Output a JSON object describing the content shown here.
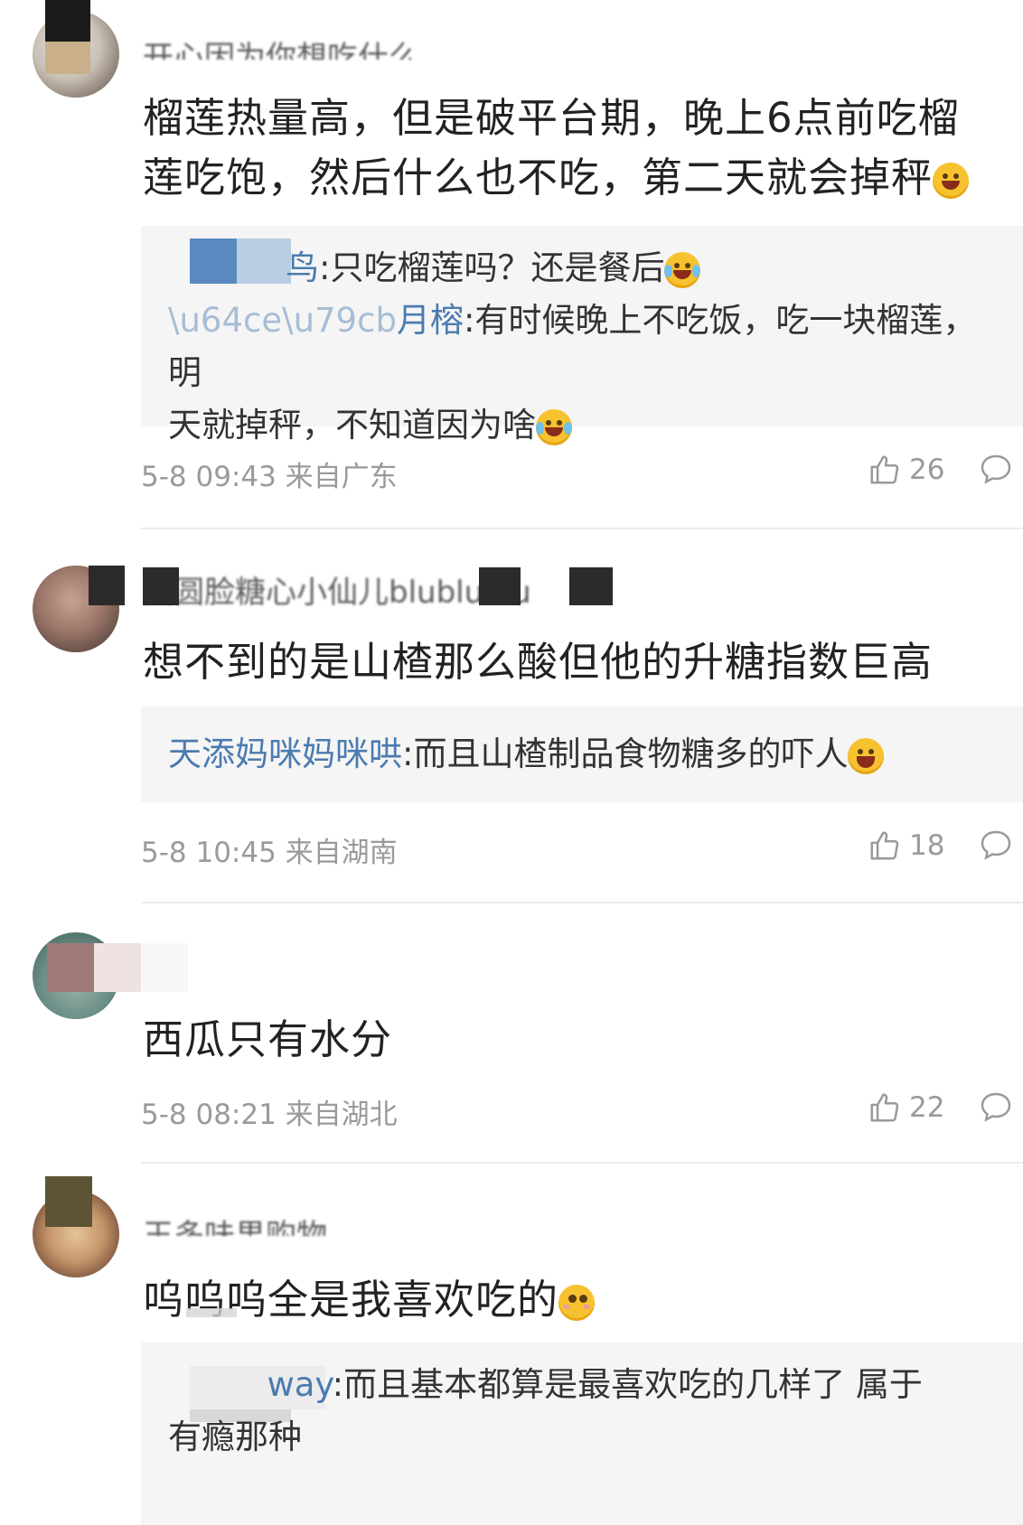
{
  "comments": [
    {
      "name": "开心因为你想吃什么",
      "text_a": "榴莲热量高，但是破平台期，晚上6点前吃榴",
      "text_b": "莲吃饱，然后什么也不吃，第二天就会掉秤",
      "emoji": "scream-emoji",
      "replies": [
        {
          "name": "鸟",
          "text": ":只吃榴莲吗？还是餐后",
          "emoji": "laugh-cry-emoji"
        },
        {
          "name": "月榕",
          "text": ":有时候晚上不吃饭，吃一块榴莲，明",
          "text_b": "天就掉秤，不知道因为啥",
          "emoji": "laugh-cry-emoji"
        }
      ],
      "meta": "5-8 09:43 来自广东",
      "likes": "26"
    },
    {
      "name": "圆圆脸糖心小仙儿blublublu",
      "text": "想不到的是山楂那么酸但他的升糖指数巨高",
      "replies": [
        {
          "name": "天添妈咪妈咪哄",
          "text": ":而且山楂制品食物糖多的吓人",
          "emoji": "grin-emoji"
        }
      ],
      "meta": "5-8 10:45 来自湖南",
      "likes": "18"
    },
    {
      "text": "西瓜只有水分",
      "meta": "5-8 08:21 来自湖北",
      "likes": "22"
    },
    {
      "name": "王多味果购物",
      "text": "呜呜呜全是我喜欢吃的",
      "emoji": "pleading-emoji",
      "replies": [
        {
          "name": "way",
          "text": ":而且基本都算是最喜欢吃的几样了 属于",
          "text_b": "有瘾那种"
        }
      ]
    }
  ]
}
